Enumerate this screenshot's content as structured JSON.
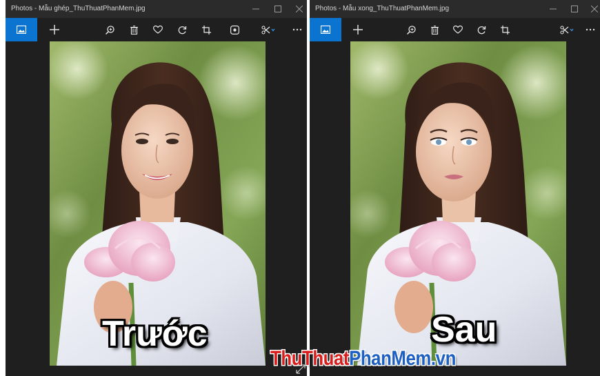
{
  "accent": "#0b74d1",
  "left_window": {
    "title": "Photos - Mẫu ghép_ThuThuatPhanMem.jpg",
    "caption": "Trước"
  },
  "right_window": {
    "title": "Photos - Mẫu xong_ThuThuatPhanMem.jpg",
    "caption": "Sau"
  },
  "toolbar_icons": [
    "photos-home-icon",
    "add-icon",
    "zoom-icon",
    "delete-icon",
    "favorite-icon",
    "rotate-icon",
    "crop-icon",
    "enhance-icon",
    "edit-icon",
    "more-icon"
  ],
  "watermark": {
    "part1": "ThuThuat",
    "part2": "PhanMem.vn"
  }
}
